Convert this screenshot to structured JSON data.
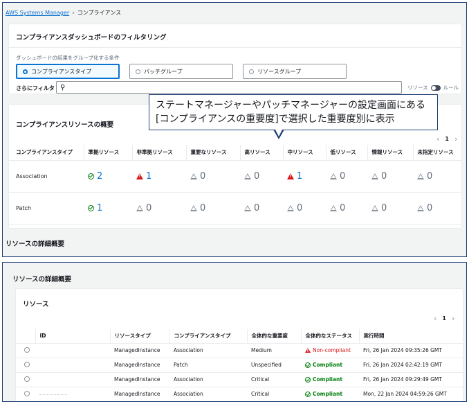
{
  "breadcrumb": {
    "root": "AWS Systems Manager",
    "current": "コンプライアンス"
  },
  "filter": {
    "title": "コンプライアンスダッシュボードのフィルタリング",
    "group_label": "ダッシュボードの結果をグループ化する条件",
    "options": [
      "コンプライアンスタイプ",
      "パッチグループ",
      "リソースグループ"
    ],
    "selected": "コンプライアンスタイプ",
    "more_filter_label": "さらにフィルタ",
    "search_value": "",
    "toggle_left": "リソース",
    "toggle_right": "ルール"
  },
  "callout": {
    "line1": "ステートマネージャーやパッチマネージャーの設定画面にある",
    "line2": "[コンプライアンスの重要度]で選択した重要度別に表示"
  },
  "summary": {
    "title": "コンプライアンスリソースの概要",
    "page": "1",
    "headers": [
      "コンプライアンスタイプ",
      "準拠リソース",
      "非準拠リソース",
      "重要なリソース",
      "高リソース",
      "中リソース",
      "低リソース",
      "情報リソース",
      "未指定リソース"
    ],
    "rows": [
      {
        "type": "Association",
        "values": [
          "2",
          "1",
          "0",
          "0",
          "1",
          "0",
          "0",
          "0"
        ]
      },
      {
        "type": "Patch",
        "values": [
          "1",
          "0",
          "0",
          "0",
          "0",
          "0",
          "0",
          "0"
        ]
      }
    ]
  },
  "detail_top_title": "リソースの詳細概要",
  "detail": {
    "title": "リソースの詳細概要",
    "card_title": "リソース",
    "page": "1",
    "headers": [
      "ID",
      "リソースタイプ",
      "コンプライアンスタイプ",
      "全体的な重要度",
      "全体的なステータス",
      "実行時間"
    ],
    "rows": [
      {
        "resource_type": "ManagedInstance",
        "compliance_type": "Association",
        "severity": "Medium",
        "status": "Non-compliant",
        "time": "Fri, 26 Jan 2024 09:35:26 GMT"
      },
      {
        "resource_type": "ManagedInstance",
        "compliance_type": "Patch",
        "severity": "Unspecified",
        "status": "Compliant",
        "time": "Fri, 26 Jan 2024 02:42:19 GMT"
      },
      {
        "resource_type": "ManagedInstance",
        "compliance_type": "Association",
        "severity": "Critical",
        "status": "Compliant",
        "time": "Fri, 26 Jan 2024 09:29:49 GMT"
      },
      {
        "resource_type": "ManagedInstance",
        "compliance_type": "Association",
        "severity": "Critical",
        "status": "Compliant",
        "time": "Mon, 22 Jan 2024 04:59:26 GMT"
      }
    ]
  },
  "colors": {
    "link": "#0972d3",
    "success": "#037f0c",
    "error": "#d91515",
    "frame": "#1f3f77"
  }
}
